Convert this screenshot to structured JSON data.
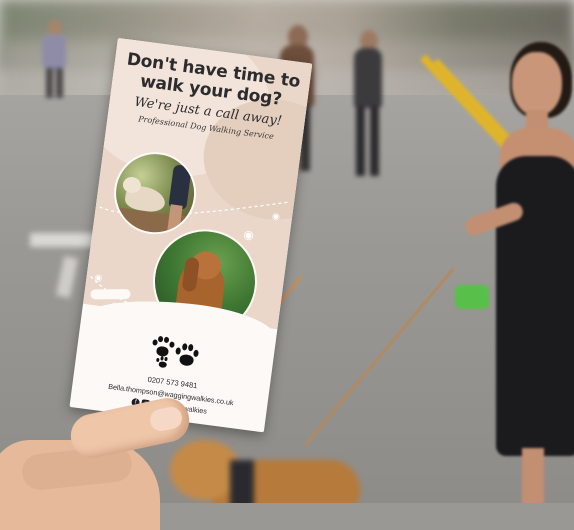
{
  "flyer": {
    "headline": "Don't have time to walk your dog?",
    "subheadline": "We're just a call away!",
    "tagline": "Professional Dog Walking Service",
    "phone": "0207 573 9481",
    "email": "Bella.thompson@waggingwalkies.co.uk",
    "social_handle": "@wagginwalkies"
  },
  "colors": {
    "flyer_top": "#ead7c9",
    "flyer_bottom": "#fcf9f7",
    "text": "#2c2b2e",
    "road_line": "#e1b528",
    "leash_handle": "#58c04a"
  },
  "icons": {
    "paw": "paw-icon",
    "facebook": "facebook-icon",
    "instagram": "instagram-icon"
  }
}
